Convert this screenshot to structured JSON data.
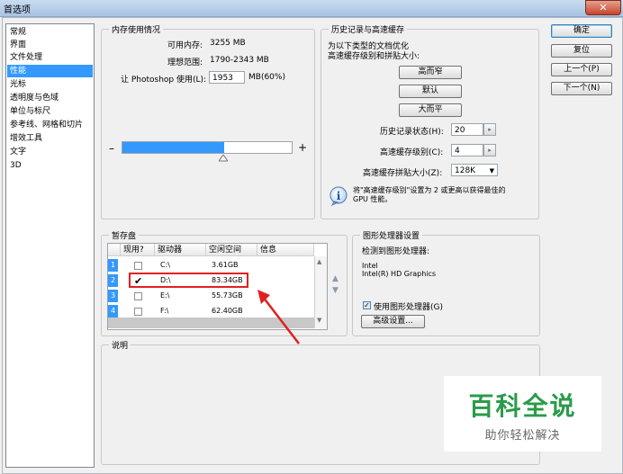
{
  "window": {
    "title": "首选项",
    "close_glyph": "✕"
  },
  "sidebar": {
    "items": [
      {
        "label": "常规",
        "selected": false
      },
      {
        "label": "界面",
        "selected": false
      },
      {
        "label": "文件处理",
        "selected": false
      },
      {
        "label": "性能",
        "selected": true
      },
      {
        "label": "光标",
        "selected": false
      },
      {
        "label": "透明度与色域",
        "selected": false
      },
      {
        "label": "单位与标尺",
        "selected": false
      },
      {
        "label": "参考线、网格和切片",
        "selected": false
      },
      {
        "label": "增效工具",
        "selected": false
      },
      {
        "label": "文字",
        "selected": false
      },
      {
        "label": "3D",
        "selected": false
      }
    ]
  },
  "memory": {
    "legend": "内存使用情况",
    "available_label": "可用内存:",
    "available_value": "3255 MB",
    "ideal_label": "理想范围:",
    "ideal_value": "1790-2343 MB",
    "let_label": "让 Photoshop 使用(L):",
    "let_value": "1953",
    "let_unit": "MB(60%)",
    "minus": "–",
    "plus": "+",
    "slider_fraction": 0.6
  },
  "history": {
    "legend": "历史记录与高速缓存",
    "desc_line1": "为以下类型的文档优化",
    "desc_line2": "高速缓存级别和拼贴大小:",
    "btn_tall": "高而窄",
    "btn_default": "默认",
    "btn_wide": "大而平",
    "states_label": "历史记录状态(H):",
    "states_value": "20",
    "cache_label": "高速缓存级别(C):",
    "cache_value": "4",
    "tile_label": "高速缓存拼贴大小(Z):",
    "tile_value": "128K",
    "info_text_line1": "将\"高速缓存级别\"设置为 2 或更高以获得最佳的",
    "info_text_line2": "GPU 性能。"
  },
  "buttons": {
    "ok": "确定",
    "reset": "复位",
    "prev": "上一个(P)",
    "next": "下一个(N)"
  },
  "scratch": {
    "legend": "暂存盘",
    "headers": [
      "现用?",
      "驱动器",
      "空闲空间",
      "信息"
    ],
    "rows": [
      {
        "num": "1",
        "active": false,
        "drive": "C:\\",
        "free": "3.61GB",
        "info": ""
      },
      {
        "num": "2",
        "active": true,
        "drive": "D:\\",
        "free": "83.34GB",
        "info": ""
      },
      {
        "num": "3",
        "active": false,
        "drive": "E:\\",
        "free": "55.73GB",
        "info": ""
      },
      {
        "num": "4",
        "active": false,
        "drive": "F:\\",
        "free": "62.40GB",
        "info": ""
      }
    ]
  },
  "gpu": {
    "legend": "图形处理器设置",
    "detected_label": "检测到图形处理器:",
    "vendor": "Intel",
    "model": "Intel(R) HD Graphics",
    "use_label": "使用图形处理器(G)",
    "use_checked": true,
    "advanced": "高级设置..."
  },
  "description": {
    "legend": "说明"
  },
  "watermark": {
    "big": "百科全说",
    "small": "助你轻松解决"
  },
  "colors": {
    "selection": "#3399ff",
    "highlight": "#e02020",
    "watermark": "#2a9b4b"
  }
}
